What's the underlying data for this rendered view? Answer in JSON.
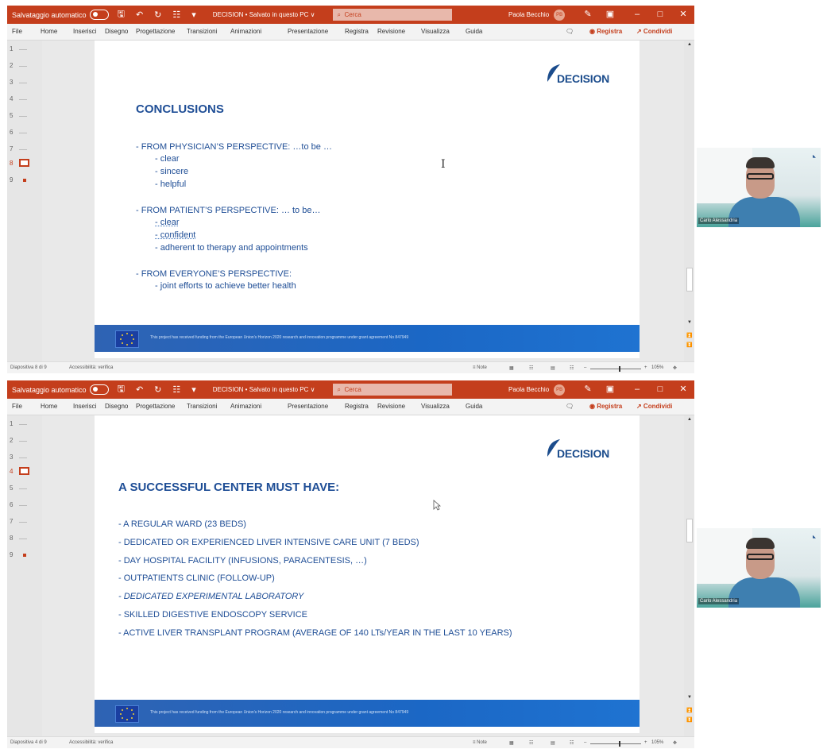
{
  "windows": [
    {
      "titlebar": {
        "autosave": "Salvataggio automatico",
        "filename": "DECISION • Salvato in questo PC ∨",
        "search_placeholder": "Cerca",
        "user_name": "Paola Becchio",
        "user_initials": "PB"
      },
      "ribbon_tabs": [
        "File",
        "Home",
        "Inserisci",
        "Disegno",
        "Progettazione",
        "Transizioni",
        "Animazioni",
        "Presentazione",
        "Registra",
        "Revisione",
        "Visualizza",
        "Guida"
      ],
      "ribbon_right": {
        "record": "◉ Registra",
        "share": "↗ Condividi"
      },
      "thumbnails": [
        "1",
        "2",
        "3",
        "4",
        "5",
        "6",
        "7",
        "8",
        "9"
      ],
      "selected_thumb": 8,
      "slide": {
        "logo": "DECISION",
        "title": "CONCLUSIONS",
        "lines": [
          "-     FROM PHYSICIAN’S PERSPECTIVE: …to be …",
          "- clear",
          "- sincere",
          "- helpful",
          "-     FROM PATIENT’S PERSPECTIVE: … to be…",
          "- clear",
          "- confident",
          "- adherent to therapy and appointments",
          "-     FROM EVERYONE’S PERSPECTIVE:",
          "- joint efforts to achieve better health"
        ],
        "footer": "This project has received funding from the European Union’s Horizon 2020 research and innovation programme under grant agreement No 847949"
      },
      "status": {
        "slide_pos": "Diapositiva 8 di 9",
        "accessibility": "Accessibilità: verifica",
        "notes": "≡ Note",
        "zoom": "105%"
      },
      "camera_name": "Carlo Alessandria"
    },
    {
      "titlebar": {
        "autosave": "Salvataggio automatico",
        "filename": "DECISION • Salvato in questo PC ∨",
        "search_placeholder": "Cerca",
        "user_name": "Paola Becchio",
        "user_initials": "PB"
      },
      "ribbon_tabs": [
        "File",
        "Home",
        "Inserisci",
        "Disegno",
        "Progettazione",
        "Transizioni",
        "Animazioni",
        "Presentazione",
        "Registra",
        "Revisione",
        "Visualizza",
        "Guida"
      ],
      "ribbon_right": {
        "record": "◉ Registra",
        "share": "↗ Condividi"
      },
      "thumbnails": [
        "1",
        "2",
        "3",
        "4",
        "5",
        "6",
        "7",
        "8",
        "9"
      ],
      "selected_thumb": 4,
      "slide": {
        "logo": "DECISION",
        "title": "A SUCCESSFUL CENTER MUST HAVE:",
        "lines": [
          "- A REGULAR WARD (23 BEDS)",
          "- DEDICATED OR EXPERIENCED LIVER INTENSIVE CARE UNIT (7 BEDS)",
          "- DAY HOSPITAL FACILITY (INFUSIONS, PARACENTESIS, …)",
          "- OUTPATIENTS CLINIC (FOLLOW-UP)",
          "- DEDICATED EXPERIMENTAL LABORATORY",
          "- SKILLED DIGESTIVE ENDOSCOPY SERVICE",
          "- ACTIVE LIVER TRANSPLANT PROGRAM (AVERAGE OF 140 LTs/YEAR IN THE LAST 10 YEARS)"
        ],
        "footer": "This project has received funding from the European Union’s Horizon 2020 research and innovation programme under grant agreement No 847949"
      },
      "status": {
        "slide_pos": "Diapositiva 4 di 9",
        "accessibility": "Accessibilità: verifica",
        "notes": "≡ Note",
        "zoom": "105%"
      },
      "camera_name": "Carlo Alessandria"
    }
  ]
}
